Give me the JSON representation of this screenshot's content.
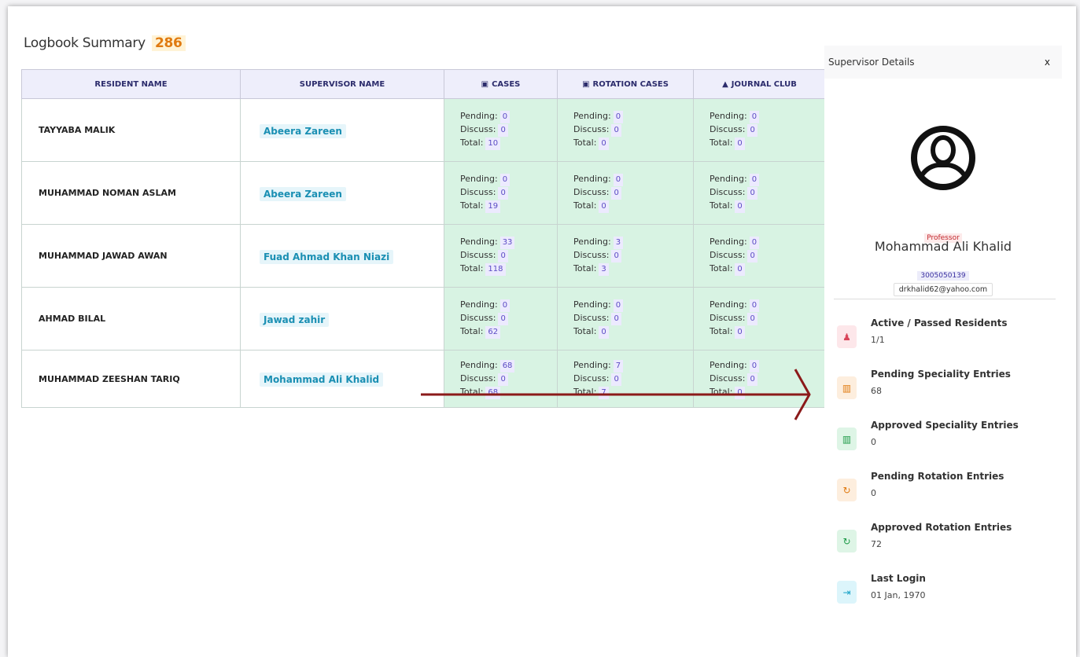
{
  "page": {
    "title": "Logbook Summary",
    "count": "286"
  },
  "table": {
    "headers": {
      "resident_name": "RESIDENT NAME",
      "supervisor_name": "SUPERVISOR NAME",
      "cases": "CASES",
      "rotation_cases": "ROTATION CASES",
      "journal_club": "JOURNAL CLUB"
    },
    "stat_labels": {
      "pending": "Pending:",
      "discuss": "Discuss:",
      "total": "Total:"
    },
    "rows": [
      {
        "resident": "TAYYABA MALIK",
        "supervisor": "Abeera Zareen",
        "cases": {
          "pending": "0",
          "discuss": "0",
          "total": "10"
        },
        "rotation": {
          "pending": "0",
          "discuss": "0",
          "total": "0"
        },
        "journal": {
          "pending": "0",
          "discuss": "0",
          "total": "0"
        }
      },
      {
        "resident": "MUHAMMAD NOMAN ASLAM",
        "supervisor": "Abeera Zareen",
        "cases": {
          "pending": "0",
          "discuss": "0",
          "total": "19"
        },
        "rotation": {
          "pending": "0",
          "discuss": "0",
          "total": "0"
        },
        "journal": {
          "pending": "0",
          "discuss": "0",
          "total": "0"
        }
      },
      {
        "resident": "MUHAMMAD JAWAD AWAN",
        "supervisor": "Fuad Ahmad Khan Niazi",
        "cases": {
          "pending": "33",
          "discuss": "0",
          "total": "118"
        },
        "rotation": {
          "pending": "3",
          "discuss": "0",
          "total": "3"
        },
        "journal": {
          "pending": "0",
          "discuss": "0",
          "total": "0"
        }
      },
      {
        "resident": "AHMAD BILAL",
        "supervisor": "Jawad zahir",
        "cases": {
          "pending": "0",
          "discuss": "0",
          "total": "62"
        },
        "rotation": {
          "pending": "0",
          "discuss": "0",
          "total": "0"
        },
        "journal": {
          "pending": "0",
          "discuss": "0",
          "total": "0"
        }
      },
      {
        "resident": "MUHAMMAD ZEESHAN TARIQ",
        "supervisor": "Mohammad Ali Khalid",
        "cases": {
          "pending": "68",
          "discuss": "0",
          "total": "68"
        },
        "rotation": {
          "pending": "7",
          "discuss": "0",
          "total": "7"
        },
        "journal": {
          "pending": "0",
          "discuss": "0",
          "total": "0"
        }
      }
    ]
  },
  "panel": {
    "title": "Supervisor Details",
    "close": "x",
    "role": "Professor",
    "name": "Mohammad Ali Khalid",
    "phone": "3005050139",
    "email": "drkhalid62@yahoo.com",
    "stats": [
      {
        "label": "Active / Passed Residents",
        "value": "1/1",
        "icon": "users-icon",
        "bg": "#fde7ea",
        "fg": "#d9465a"
      },
      {
        "label": "Pending Speciality Entries",
        "value": "68",
        "icon": "briefcase-icon",
        "bg": "#fdeede",
        "fg": "#e07a10"
      },
      {
        "label": "Approved Speciality Entries",
        "value": "0",
        "icon": "briefcase-icon",
        "bg": "#def5e6",
        "fg": "#1e9a48"
      },
      {
        "label": "Pending Rotation Entries",
        "value": "0",
        "icon": "refresh-icon",
        "bg": "#fdeede",
        "fg": "#e07a10"
      },
      {
        "label": "Approved Rotation Entries",
        "value": "72",
        "icon": "refresh-icon",
        "bg": "#def5e6",
        "fg": "#1e9a48"
      },
      {
        "label": "Last Login",
        "value": "01 Jan, 1970",
        "icon": "login-icon",
        "bg": "#dcf5fb",
        "fg": "#1aa3c8"
      }
    ]
  },
  "colors": {
    "cases_header": "#e9555e",
    "rotation_header": "#6c757d",
    "journal_header": "#17b9e0",
    "stat_cell": "#d8f3e3",
    "arrow": "#8b1a1a"
  }
}
